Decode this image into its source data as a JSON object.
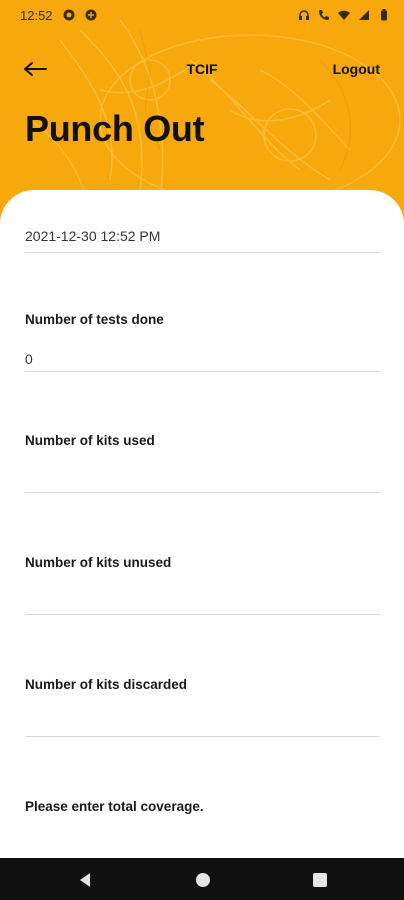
{
  "status_bar": {
    "time": "12:52"
  },
  "app_bar": {
    "title": "TCIF",
    "logout_label": "Logout"
  },
  "page": {
    "title": "Punch Out"
  },
  "form": {
    "datetime": "2021-12-30 12:52 PM",
    "fields": [
      {
        "label": "Number of tests done",
        "value": "0"
      },
      {
        "label": "Number of kits used",
        "value": ""
      },
      {
        "label": "Number of kits unused",
        "value": ""
      },
      {
        "label": "Number of kits discarded",
        "value": ""
      }
    ],
    "coverage_prompt": "Please enter total coverage."
  },
  "colors": {
    "header_bg": "#f6a80c",
    "text": "#111111",
    "divider": "#d8d8d8"
  }
}
